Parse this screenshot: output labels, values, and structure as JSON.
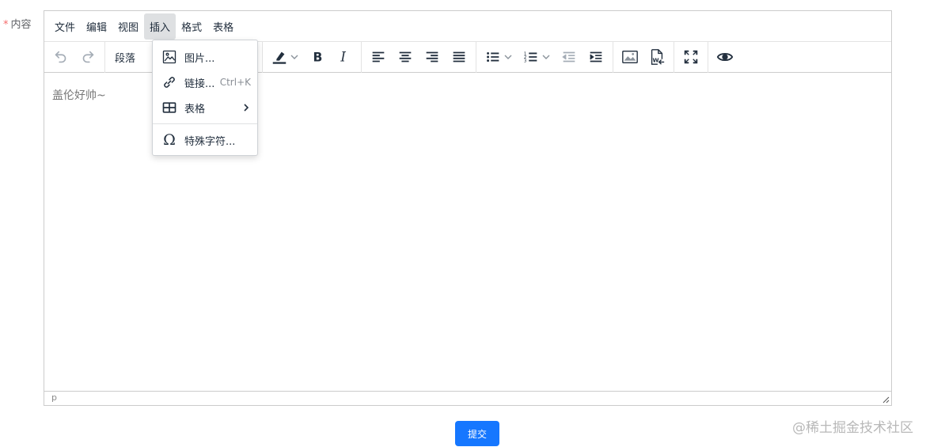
{
  "form": {
    "required_mark": "*",
    "label": "内容"
  },
  "menubar": {
    "items": [
      {
        "label": "文件"
      },
      {
        "label": "编辑"
      },
      {
        "label": "视图"
      },
      {
        "label": "插入",
        "active": true
      },
      {
        "label": "格式"
      },
      {
        "label": "表格"
      }
    ]
  },
  "toolbar": {
    "blocks_label": "段落",
    "icons": [
      "undo-icon",
      "redo-icon",
      "highlight-color-icon",
      "bold-icon",
      "italic-icon",
      "align-left-icon",
      "align-center-icon",
      "align-right-icon",
      "align-justify-icon",
      "bullet-list-icon",
      "numbered-list-icon",
      "outdent-icon",
      "indent-icon",
      "image-icon",
      "import-word-icon",
      "fullscreen-icon",
      "preview-icon"
    ]
  },
  "insert_menu": {
    "items": [
      {
        "label": "图片...",
        "icon": "image-icon"
      },
      {
        "label": "链接...",
        "shortcut": "Ctrl+K",
        "icon": "link-icon"
      },
      {
        "label": "表格",
        "icon": "table-icon",
        "submenu": true
      },
      {
        "label": "特殊字符...",
        "icon": "omega-icon"
      }
    ]
  },
  "editor": {
    "content": "盖伦好帅~",
    "status_path": "p"
  },
  "submit_label": "提交",
  "watermark": "@稀土掘金技术社区",
  "colors": {
    "primary": "#1677ff",
    "required": "#f56c6c",
    "menu_active": "#dee0e2"
  }
}
